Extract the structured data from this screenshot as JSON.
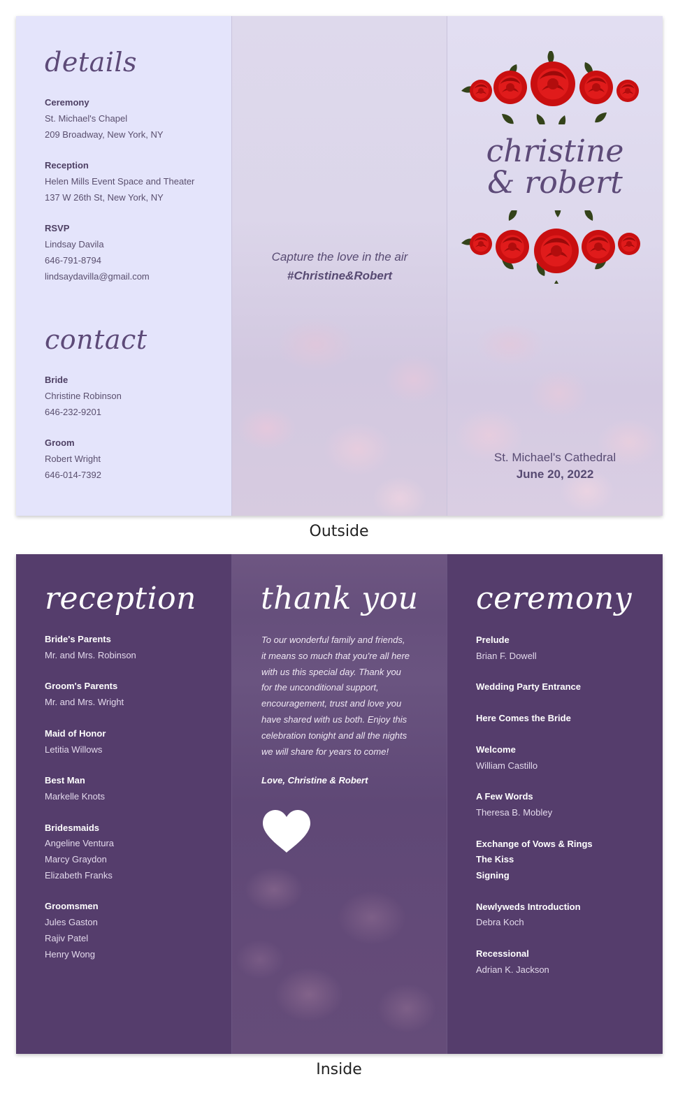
{
  "outside": {
    "details_heading": "details",
    "details": [
      {
        "label": "Ceremony",
        "lines": [
          "St. Michael's Chapel",
          "209 Broadway, New York, NY"
        ]
      },
      {
        "label": "Reception",
        "lines": [
          "Helen Mills Event Space and Theater",
          "137 W 26th St, New York, NY"
        ]
      },
      {
        "label": "RSVP",
        "lines": [
          "Lindsay Davila",
          "646-791-8794",
          "lindsaydavilla@gmail.com"
        ]
      }
    ],
    "contact_heading": "contact",
    "contacts": [
      {
        "label": "Bride",
        "lines": [
          "Christine Robinson",
          "646-232-9201"
        ]
      },
      {
        "label": "Groom",
        "lines": [
          "Robert Wright",
          "646-014-7392"
        ]
      }
    ],
    "tagline": "Capture the love in the air",
    "hashtag": "#Christine&Robert",
    "names_line1": "christine",
    "names_line2": "& robert",
    "venue": "St. Michael's Cathedral",
    "date": "June 20, 2022",
    "caption": "Outside"
  },
  "inside": {
    "reception_heading": "reception",
    "reception": [
      {
        "label": "Bride's Parents",
        "lines": [
          "Mr. and Mrs. Robinson"
        ]
      },
      {
        "label": "Groom's Parents",
        "lines": [
          "Mr. and Mrs. Wright"
        ]
      },
      {
        "label": "Maid of Honor",
        "lines": [
          "Letitia Willows"
        ]
      },
      {
        "label": "Best Man",
        "lines": [
          "Markelle Knots"
        ]
      },
      {
        "label": "Bridesmaids",
        "lines": [
          "Angeline Ventura",
          "Marcy Graydon",
          "Elizabeth Franks"
        ]
      },
      {
        "label": "Groomsmen",
        "lines": [
          "Jules Gaston",
          "Rajiv Patel",
          "Henry Wong"
        ]
      }
    ],
    "thanks_heading": "thank you",
    "thanks_lines": [
      "To our wonderful family and friends,",
      "it means so much that you're all here",
      "with us this special day. Thank you",
      "for the unconditional support,",
      "encouragement, trust and love you",
      "have shared with us both. Enjoy this",
      "celebration tonight and all the nights",
      "we will share for years to come!"
    ],
    "signoff": "Love, Christine & Robert",
    "ceremony_heading": "ceremony",
    "ceremony": [
      {
        "label": "Prelude",
        "lines": [
          "Brian F. Dowell"
        ]
      },
      {
        "label": "Wedding Party Entrance",
        "lines": []
      },
      {
        "label": "Here Comes the Bride",
        "lines": []
      },
      {
        "label": "Welcome",
        "lines": [
          "William Castillo"
        ]
      },
      {
        "label": "A Few Words",
        "lines": [
          "Theresa B. Mobley"
        ]
      },
      {
        "label": "Exchange of Vows & Rings",
        "extra_labels": [
          "The Kiss",
          "Signing"
        ],
        "lines": []
      },
      {
        "label": "Newlyweds Introduction",
        "lines": [
          "Debra Koch"
        ]
      },
      {
        "label": "Recessional",
        "lines": [
          "Adrian K. Jackson"
        ]
      }
    ],
    "caption": "Inside"
  },
  "colors": {
    "plum": "#553d6c",
    "lavender": "#e4e4fb",
    "rose_red": "#d31414",
    "leaf_green": "#3b4a17"
  },
  "icons": [
    "rose-garland-icon",
    "heart-icon"
  ]
}
